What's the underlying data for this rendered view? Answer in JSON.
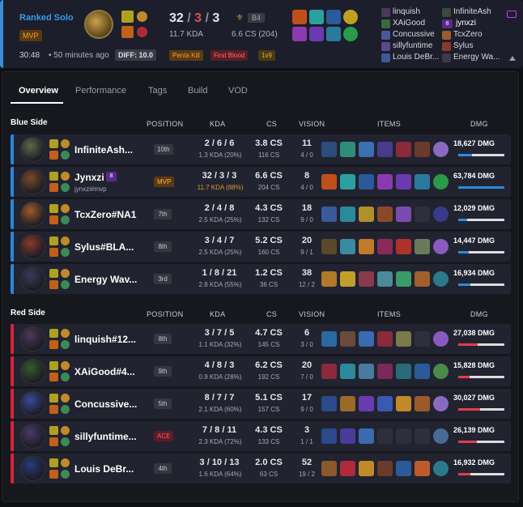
{
  "summary": {
    "queue": "Ranked Solo",
    "mvp_badge": "MVP",
    "kda_k": "32",
    "kda_slash1": " / ",
    "kda_d": "3",
    "kda_slash2": " / ",
    "kda_a": "3",
    "kda_ratio": "11.7 KDA",
    "rank_badge": "B4",
    "cs": "6.6 CS (204)",
    "duration": "30:48",
    "time_ago": "50 minutes ago",
    "diff": "DIFF: 10.0",
    "tags": [
      "Penta Kill",
      "First Blood",
      "1v9"
    ],
    "left_players": [
      "linquish",
      "XAiGood",
      "Concussive",
      "sillyfuntime",
      "Louis DeBr..."
    ],
    "right_players": [
      "InfiniteAsh",
      "jynxzi",
      "TcxZero",
      "Sylus",
      "Energy Wa..."
    ],
    "jynxzi_badge": "8"
  },
  "tabs": [
    "Overview",
    "Performance",
    "Tags",
    "Build",
    "VOD"
  ],
  "headers": {
    "position": "POSITION",
    "kda": "KDA",
    "cs": "CS",
    "vision": "VISION",
    "items": "ITEMS",
    "dmg": "DMG"
  },
  "blue": {
    "title": "Blue Side",
    "rows": [
      {
        "name": "InfiniteAsh...",
        "pos": "10th",
        "kda": "2 / 6 / 6",
        "kdasub": "1.3 KDA (20%)",
        "cs": "3.8 CS",
        "cssub": "116 CS",
        "vis": "11",
        "vissub": "4 / 0",
        "dmg": "18,627 DMG",
        "dmg_frac": 0.29,
        "items": [
          "#2a4d7a",
          "#2e8d7a",
          "#3a6fb0",
          "#4a3a8a",
          "#8a2a3a",
          "#6a3a2a",
          "#8a6ac0"
        ]
      },
      {
        "name": "Jynxzi",
        "badge": "8",
        "tag": "jynxzi#mvp",
        "pos": "MVP",
        "kda": "32 / 3 / 3",
        "kdasub": "11.7 KDA (88%)",
        "cs": "6.6 CS",
        "cssub": "204 CS",
        "vis": "8",
        "vissub": "4 / 0",
        "dmg": "63,784 DMG",
        "dmg_frac": 1.0,
        "items": [
          "#c0501a",
          "#2aa0a0",
          "#2a5a9a",
          "#8a3ab0",
          "#6a3ab0",
          "#2a7aa0",
          "#2a9a4a"
        ]
      },
      {
        "name": "TcxZero#NA1",
        "pos": "7th",
        "kda": "2 / 4 / 8",
        "kdasub": "2.5 KDA (25%)",
        "cs": "4.3 CS",
        "cssub": "132 CS",
        "vis": "18",
        "vissub": "9 / 0",
        "dmg": "12,029 DMG",
        "dmg_frac": 0.19,
        "items": [
          "#3a5a9a",
          "#2a8a9a",
          "#b0902a",
          "#8a4a2a",
          "#7a4ab0",
          "#2e2f3a",
          "#3a3a8a"
        ]
      },
      {
        "name": "Sylus#BLA...",
        "pos": "8th",
        "kda": "3 / 4 / 7",
        "kdasub": "2.5 KDA (25%)",
        "cs": "5.2 CS",
        "cssub": "160 CS",
        "vis": "20",
        "vissub": "9 / 1",
        "dmg": "14,447 DMG",
        "dmg_frac": 0.23,
        "items": [
          "#5a4a2a",
          "#3a8aa0",
          "#c07a2a",
          "#8a2a5a",
          "#b0302a",
          "#6a7a5a",
          "#8a5ac0"
        ]
      },
      {
        "name": "Energy Wav...",
        "pos": "3rd",
        "kda": "1 / 8 / 21",
        "kdasub": "2.8 KDA (55%)",
        "cs": "1.2 CS",
        "cssub": "36 CS",
        "vis": "38",
        "vissub": "12 / 2",
        "dmg": "16,934 DMG",
        "dmg_frac": 0.27,
        "items": [
          "#b07a2a",
          "#c0a02a",
          "#8a3a4a",
          "#4a8a9a",
          "#3a9a6a",
          "#a0602a",
          "#2a7a8a"
        ]
      }
    ]
  },
  "red": {
    "title": "Red Side",
    "rows": [
      {
        "name": "linquish#12...",
        "pos": "8th",
        "kda": "3 / 7 / 5",
        "kdasub": "1.1 KDA (32%)",
        "cs": "4.7 CS",
        "cssub": "145 CS",
        "vis": "6",
        "vissub": "3 / 0",
        "dmg": "27,038 DMG",
        "dmg_frac": 0.42,
        "items": [
          "#2a6aa0",
          "#6a4a3a",
          "#3a6ab0",
          "#8a2a3a",
          "#7a7a4a",
          "#2e2f3a",
          "#8a5ac0"
        ]
      },
      {
        "name": "XAiGood#4...",
        "pos": "9th",
        "kda": "4 / 8 / 3",
        "kdasub": "0.9 KDA (28%)",
        "cs": "6.2 CS",
        "cssub": "192 CS",
        "vis": "20",
        "vissub": "7 / 0",
        "dmg": "15,828 DMG",
        "dmg_frac": 0.25,
        "items": [
          "#8a2a3a",
          "#2a8a9a",
          "#4a7aa0",
          "#7a2a5a",
          "#2a6a7a",
          "#2a5a9a",
          "#4a8a4a"
        ]
      },
      {
        "name": "Concussive...",
        "pos": "5th",
        "kda": "8 / 7 / 7",
        "kdasub": "2.1 KDA (60%)",
        "cs": "5.1 CS",
        "cssub": "157 CS",
        "vis": "17",
        "vissub": "9 / 0",
        "dmg": "30,027 DMG",
        "dmg_frac": 0.47,
        "items": [
          "#2a4a8a",
          "#9a6a2a",
          "#6a3ab0",
          "#3a5ab0",
          "#c08a2a",
          "#9a5a2a",
          "#8a6ac0"
        ]
      },
      {
        "name": "sillyfuntime...",
        "pos": "ACE",
        "kda": "7 / 8 / 11",
        "kdasub": "2.3 KDA (72%)",
        "cs": "4.3 CS",
        "cssub": "133 CS",
        "vis": "3",
        "vissub": "1 / 1",
        "dmg": "26,139 DMG",
        "dmg_frac": 0.41,
        "items": [
          "#2a4a8a",
          "#4a3a9a",
          "#3a6ab0",
          "#2e2f3a",
          "#2e2f3a",
          "#2e2f3a",
          "#4a6a9a"
        ]
      },
      {
        "name": "Louis DeBr...",
        "pos": "4th",
        "kda": "3 / 10 / 13",
        "kdasub": "1.6 KDA (64%)",
        "cs": "2.0 CS",
        "cssub": "63 CS",
        "vis": "52",
        "vissub": "19 / 2",
        "dmg": "16,932 DMG",
        "dmg_frac": 0.27,
        "items": [
          "#8a5a2a",
          "#b02a3a",
          "#c08a2a",
          "#6a3a2a",
          "#2a5a9a",
          "#c05a2a",
          "#2a7a8a"
        ]
      }
    ]
  },
  "colors": {
    "blue": "#2a84d8",
    "red": "#d8243a",
    "accent": "#3a8dd8"
  },
  "icons": [
    "video-icon",
    "chevron-up-icon"
  ]
}
